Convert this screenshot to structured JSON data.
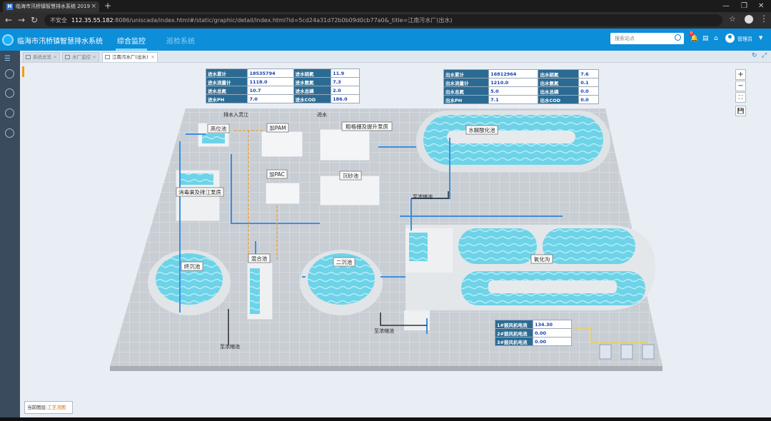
{
  "browser": {
    "tab_title": "临海市汛桥镇智慧排水系统 2019",
    "insecure_label": "不安全",
    "url_host": "112.35.55.182",
    "url_path": ":8086/uniscada/index.html#/static/graphic/detail/index.html?id=5cd24a31d72b0b09d0cb77a0&_title=江南污水厂(出水)"
  },
  "app": {
    "title": "临海市汛桥镇智慧排水系统",
    "nav": [
      "综合监控",
      "巡检系统"
    ],
    "search_placeholder": "搜索站点",
    "notification_count": "0",
    "user_name": "管理员"
  },
  "page_tabs": [
    "系统总览",
    "水厂监控",
    "江南污水厂(出水)"
  ],
  "inlet_table": [
    [
      "进水累计",
      "18535794",
      "进水硝氮",
      "11.9"
    ],
    [
      "进水流量计",
      "1118.0",
      "进水氨氮",
      "7.3"
    ],
    [
      "进水总氮",
      "10.7",
      "进水总磷",
      "2.0"
    ],
    [
      "进水PH",
      "7.0",
      "进水COD",
      "186.0"
    ]
  ],
  "outlet_table": [
    [
      "出水累计",
      "16812964",
      "出水硝氮",
      "7.6"
    ],
    [
      "出水流量计",
      "1210.0",
      "出水氨氮",
      "0.1"
    ],
    [
      "出水总氮",
      "5.0",
      "出水总磷",
      "0.0"
    ],
    [
      "出水PH",
      "7.1",
      "出水COD",
      "0.0"
    ]
  ],
  "blower_table": [
    [
      "1#鼓风机电流",
      "134.30"
    ],
    [
      "2#鼓风机电流",
      "0.00"
    ],
    [
      "3#鼓风机电流",
      "0.00"
    ]
  ],
  "labels": {
    "high_tank": "高位池",
    "pam": "加PAM",
    "pac": "加PAC",
    "coarse_screen": "粗格栅及提升泵房",
    "grit": "沉砂池",
    "disinfect": "消毒渠及排江泵房",
    "hydrolysis": "水解酸化池",
    "final_clarifier": "终沉池",
    "mixing": "混合池",
    "secondary_clarifier": "二沉池",
    "oxidation_ditch": "氧化沟"
  },
  "flow_labels": {
    "discharge": "排水入灵江",
    "inlet": "进水",
    "to_sludge1": "至浓缩池",
    "to_sludge2": "至浓缩池",
    "to_sludge3": "至浓缩池"
  },
  "zoom_controls": [
    "+",
    "−",
    "⛶",
    "💾"
  ],
  "status": {
    "prefix": "当前图层:",
    "value": "工艺流图"
  },
  "colors": {
    "header": "#0d8ed8",
    "sidebar": "#394b5c",
    "table_label_bg": "#2b6b93",
    "table_value": "#1a3fb5",
    "water": "#6fd3e8",
    "pipe": "#3a8fe0"
  }
}
